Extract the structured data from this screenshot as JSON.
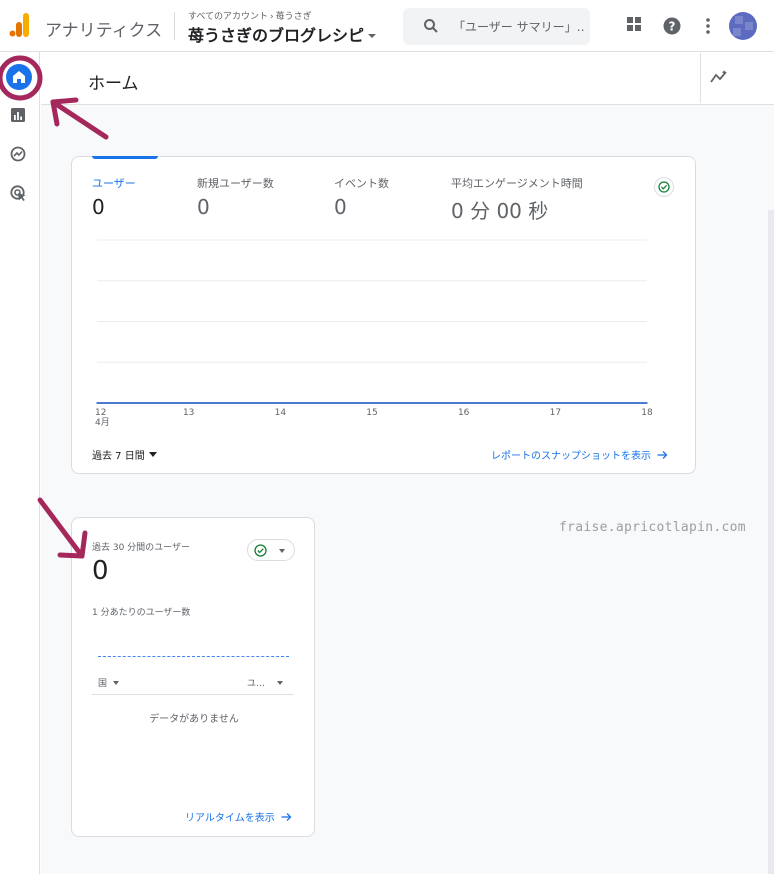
{
  "topbar": {
    "app_name": "アナリティクス",
    "breadcrumb_root": "すべてのアカウント",
    "breadcrumb_account": "苺うさぎ",
    "property_name": "苺うさぎのブログレシピ",
    "search_placeholder": "「ユーザー サマリー」…"
  },
  "page": {
    "title": "ホーム"
  },
  "overview_card": {
    "metrics": [
      {
        "label": "ユーザー",
        "value": "0"
      },
      {
        "label": "新規ユーザー数",
        "value": "0"
      },
      {
        "label": "イベント数",
        "value": "0"
      },
      {
        "label": "平均エンゲージメント時間",
        "value": "0 分 00 秒"
      }
    ],
    "date_range": "過去 7 日間",
    "snapshot_link": "レポートのスナップショットを表示"
  },
  "chart_data": {
    "type": "line",
    "x": [
      "12",
      "13",
      "14",
      "15",
      "16",
      "17",
      "18"
    ],
    "x_sublabel": "4月",
    "series": [
      {
        "values": [
          0,
          0,
          0,
          0,
          0,
          0,
          0
        ]
      }
    ],
    "grid": true,
    "color": "#4a7bd0"
  },
  "realtime_card": {
    "title": "過去 30 分間のユーザー",
    "value": "0",
    "per_minute_label": "1 分あたりのユーザー数",
    "col_country": "国",
    "col_users": "ユ…",
    "no_data": "データがありません",
    "realtime_link": "リアルタイムを表示"
  },
  "watermark": "fraise.apricotlapin.com",
  "colors": {
    "accent": "#1a73e8",
    "annotation": "#a4285b",
    "success": "#188038"
  }
}
